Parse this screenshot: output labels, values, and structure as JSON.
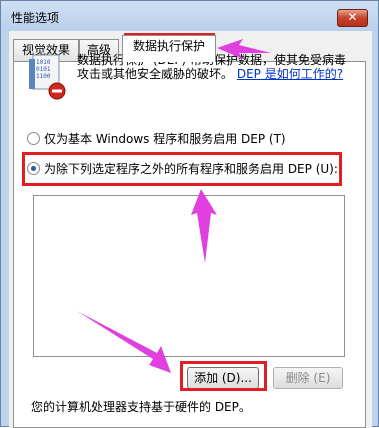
{
  "window": {
    "title": "性能选项",
    "close_label": "✕"
  },
  "tabs": [
    {
      "label": "视觉效果"
    },
    {
      "label": "高级"
    },
    {
      "label": "数据执行保护"
    }
  ],
  "dep": {
    "description": "数据执行保护 (DEP) 帮助保护数据，使其免受病毒攻击或其他安全威胁的破坏。",
    "link_text": "DEP 是如何工作的?",
    "icon": "dep-shield-icon"
  },
  "options": {
    "essential_only": "仅为基本 Windows 程序和服务启用 DEP (T)",
    "all_except": "为除下列选定程序之外的所有程序和服务启用 DEP (U):",
    "selected": "all_except"
  },
  "buttons": {
    "add": "添加 (D)...",
    "remove": "删除 (E)"
  },
  "footer": {
    "hardware_note": "您的计算机处理器支持基于硬件的 DEP。"
  },
  "annotation_color": "#e02020",
  "arrow_color": "#e040e0"
}
